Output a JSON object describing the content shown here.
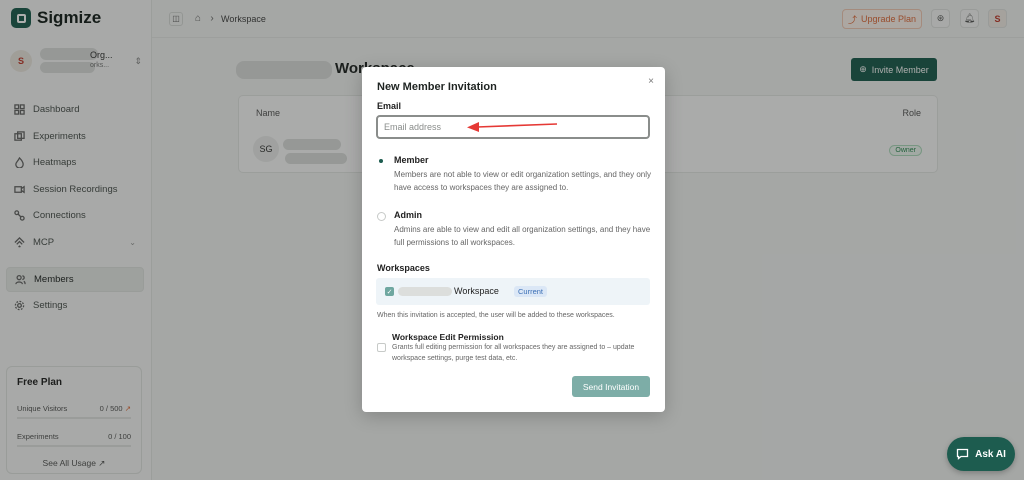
{
  "app": {
    "name": "Sigmize"
  },
  "org": {
    "avatar": "S",
    "name_suffix": "Org...",
    "sub_suffix": "orks..."
  },
  "sidebar": {
    "items": [
      {
        "label": "Dashboard",
        "icon": "dashboard-icon"
      },
      {
        "label": "Experiments",
        "icon": "experiments-icon"
      },
      {
        "label": "Heatmaps",
        "icon": "heatmaps-icon"
      },
      {
        "label": "Session Recordings",
        "icon": "video-icon"
      },
      {
        "label": "Connections",
        "icon": "connections-icon"
      },
      {
        "label": "MCP",
        "icon": "mcp-icon"
      },
      {
        "label": "Members",
        "icon": "members-icon",
        "active": true
      },
      {
        "label": "Settings",
        "icon": "gear-icon"
      }
    ]
  },
  "plan": {
    "title": "Free Plan",
    "visitors_label": "Unique Visitors",
    "visitors_value": "0 / 500",
    "experiments_label": "Experiments",
    "experiments_value": "0 / 100",
    "link": "See All Usage ↗"
  },
  "topbar": {
    "breadcrumb": "Workspace",
    "upgrade": "Upgrade Plan",
    "user_avatar": "S"
  },
  "page": {
    "title_suffix": "Workspace",
    "invite_button": "Invite Member",
    "table": {
      "col_name": "Name",
      "col_role": "Role",
      "row_avatar": "SG",
      "row_role": "Owner"
    }
  },
  "modal": {
    "title": "New Member Invitation",
    "close": "×",
    "email_label": "Email",
    "email_placeholder": "Email address",
    "roles": [
      {
        "title": "Member",
        "desc": "Members are not able to view or edit organization settings, and they only have access to workspaces they are assigned to.",
        "selected": true
      },
      {
        "title": "Admin",
        "desc": "Admins are able to view and edit all organization settings, and they have full permissions to all workspaces.",
        "selected": false
      }
    ],
    "workspaces_label": "Workspaces",
    "workspace_name": "Workspace",
    "workspace_badge": "Current",
    "workspace_note": "When this invitation is accepted, the user will be added to these workspaces.",
    "permission_title": "Workspace Edit Permission",
    "permission_desc": "Grants full editing permission for all workspaces they are assigned to – update workspace settings, purge test data, etc.",
    "send_button": "Send Invitation"
  },
  "ask_ai": "Ask AI",
  "colors": {
    "brand": "#1d5c4f",
    "accent_orange": "#e06c3c",
    "arrow": "#e53935"
  }
}
